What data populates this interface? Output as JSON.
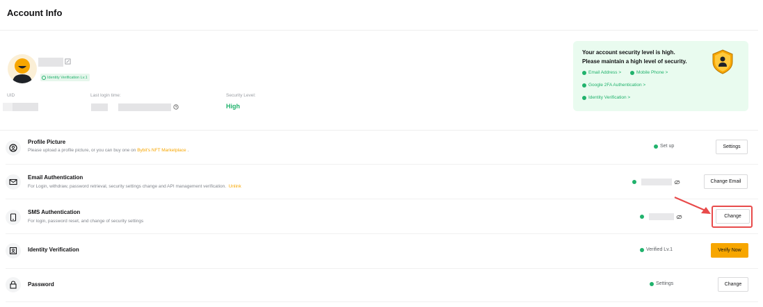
{
  "page": {
    "title": "Account Info"
  },
  "profile": {
    "badge": "Identity Verification Lv.1",
    "uid_label": "UID",
    "last_login_label": "Last login time:",
    "security_label": "Security Level:",
    "security_value": "High"
  },
  "security_card": {
    "line1": "Your account security level is high.",
    "line2": "Please maintain a high level of security.",
    "links": [
      "Email Address >",
      "Mobile Phone >",
      "Google 2FA Authentication >",
      "Identity Verification >"
    ]
  },
  "rows": [
    {
      "title": "Profile Picture",
      "desc": "Please upload a profile picture, or you can buy one on ",
      "desc_link": "Bybit's NFT Marketplace",
      "desc_tail": ".",
      "status": "Set up",
      "button": "Settings"
    },
    {
      "title": "Email Authentication",
      "desc": "For Login, withdraw, password retrieval, security settings change and API management verification.",
      "desc_link": "Unlink",
      "button": "Change Email"
    },
    {
      "title": "SMS Authentication",
      "desc": "For login, password reset, and change of security settings",
      "button": "Change"
    },
    {
      "title": "Identity Verification",
      "status": "Verified Lv.1",
      "button": "Verify Now"
    },
    {
      "title": "Password",
      "status": "Settings",
      "button": "Change"
    }
  ],
  "colors": {
    "accent": "#f7a600",
    "success": "#20b26c",
    "highlight": "#e84a4a"
  }
}
